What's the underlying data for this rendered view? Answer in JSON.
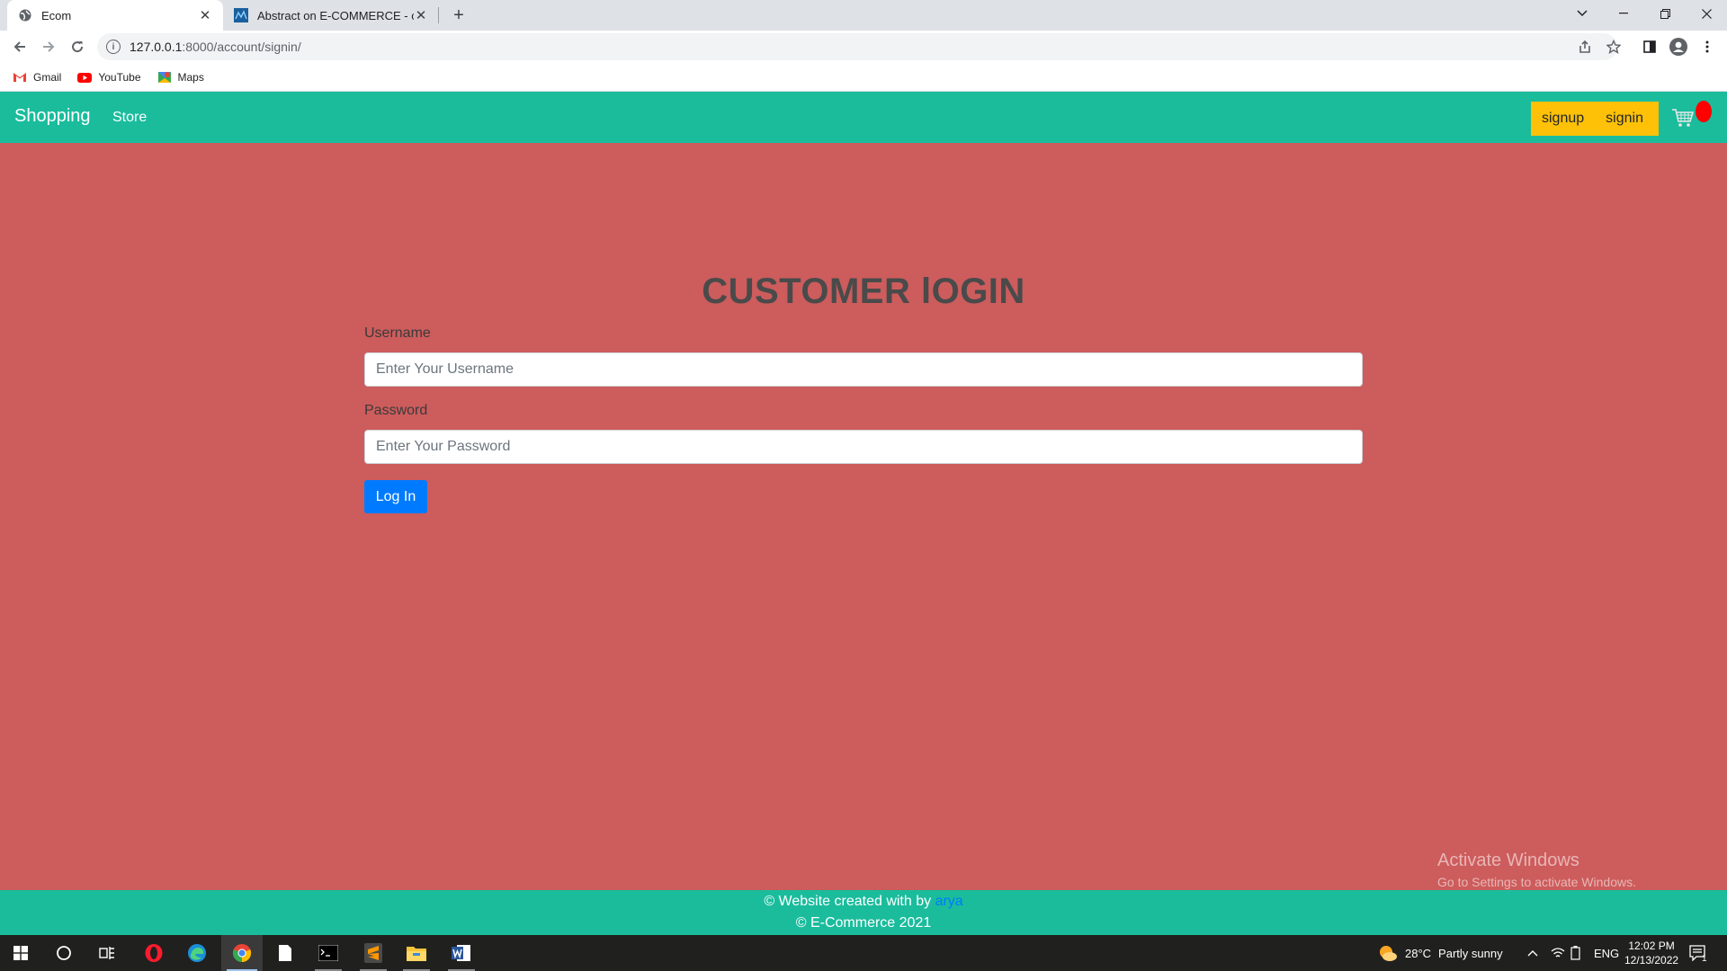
{
  "browser": {
    "tabs": [
      {
        "title": "Ecom",
        "close": "✕"
      },
      {
        "title": "Abstract on E-COMMERCE - crea",
        "close": "✕"
      }
    ],
    "new_tab": "+",
    "url_host": "127.0.0.1",
    "url_path": ":8000/account/signin/",
    "bookmarks": [
      {
        "label": "Gmail"
      },
      {
        "label": "YouTube"
      },
      {
        "label": "Maps"
      }
    ]
  },
  "site": {
    "brand": "Shopping",
    "nav_store": "Store",
    "signup": "signup",
    "signin": "signin",
    "nav_color": "#1abc9c",
    "bg_color": "#cd5c5c",
    "auth_color": "#ffc107"
  },
  "login": {
    "title": "CUSTOMER lOGIN",
    "username_label": "Username",
    "username_placeholder": "Enter Your Username",
    "password_label": "Password",
    "password_placeholder": "Enter Your Password",
    "submit": "Log In",
    "button_color": "#007bff"
  },
  "footer": {
    "line1_prefix": "© Website created with by ",
    "author": "arya",
    "line2": "© E-Commerce 2021"
  },
  "watermark": {
    "title": "Activate Windows",
    "subtitle": "Go to Settings to activate Windows."
  },
  "taskbar": {
    "weather_temp": "28°C",
    "weather_desc": "Partly sunny",
    "lang": "ENG",
    "time": "12:02 PM",
    "date": "12/13/2022",
    "notification_count": "1"
  }
}
